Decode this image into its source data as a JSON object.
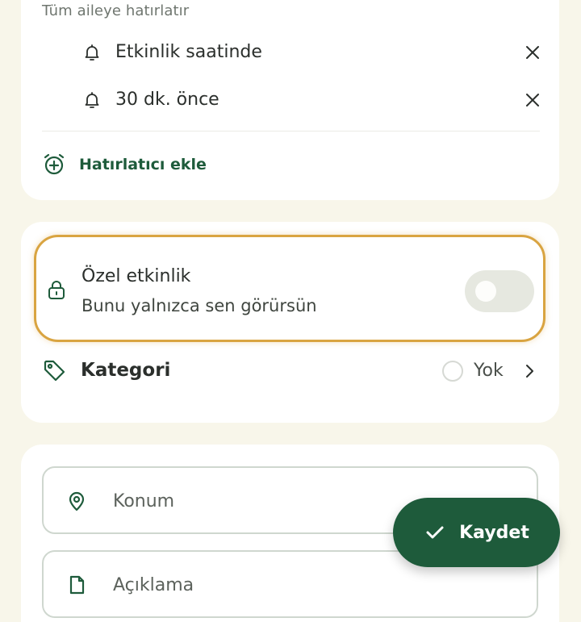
{
  "reminders": {
    "subtitle": "Tüm aileye hatırlatır",
    "items": [
      {
        "label": "Etkinlik saatinde",
        "icon": "bell-icon"
      },
      {
        "label": "30 dk. önce",
        "icon": "bell-icon"
      }
    ],
    "add_label": "Hatırlatıcı ekle"
  },
  "privacy": {
    "title": "Özel etkinlik",
    "description": "Bunu yalnızca sen görürsün",
    "enabled": false
  },
  "category": {
    "label": "Kategori",
    "value": "Yok"
  },
  "location": {
    "placeholder": "Konum"
  },
  "description": {
    "placeholder": "Açıklama"
  },
  "save": {
    "label": "Kaydet"
  },
  "colors": {
    "accent": "#1e5b3b",
    "highlight": "#d9a441",
    "background": "#f8f6ea"
  }
}
